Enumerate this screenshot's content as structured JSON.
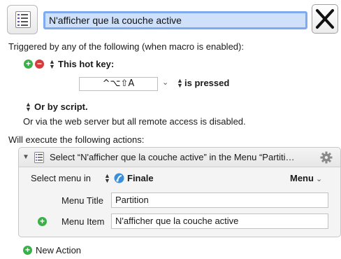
{
  "header": {
    "macro_name": "N'afficher que la couche active"
  },
  "triggers": {
    "intro": "Triggered by any of the following (when macro is enabled):",
    "hotkey_label": "This hot key:",
    "hotkey_value": "^⌥⇧A",
    "hotkey_condition": "is pressed",
    "script_label": "Or by script.",
    "web_server_note": "Or via the web server but all remote access is disabled."
  },
  "actions": {
    "intro": "Will execute the following actions:",
    "action_title": "Select “N'afficher que la couche active” in the Menu “Partiti…",
    "select_menu_label": "Select menu in",
    "app_name": "Finale",
    "menu_dropdown_label": "Menu",
    "menu_title_label": "Menu Title",
    "menu_title_value": "Partition",
    "menu_item_label": "Menu Item",
    "menu_item_value": "N'afficher que la couche active",
    "new_action_label": "New Action"
  },
  "colors": {
    "accent_green": "#3bb04a",
    "accent_red": "#d83b3b",
    "selection_blue": "#cfe0fb",
    "focus_ring": "#7eaaf0"
  },
  "icons": {
    "macro": "list-document-icon",
    "close": "x-icon",
    "add": "plus-circle-icon",
    "remove": "minus-circle-icon",
    "gear": "gear-icon",
    "disclosure": "disclosure-triangle-icon",
    "app": "finale-app-icon"
  }
}
